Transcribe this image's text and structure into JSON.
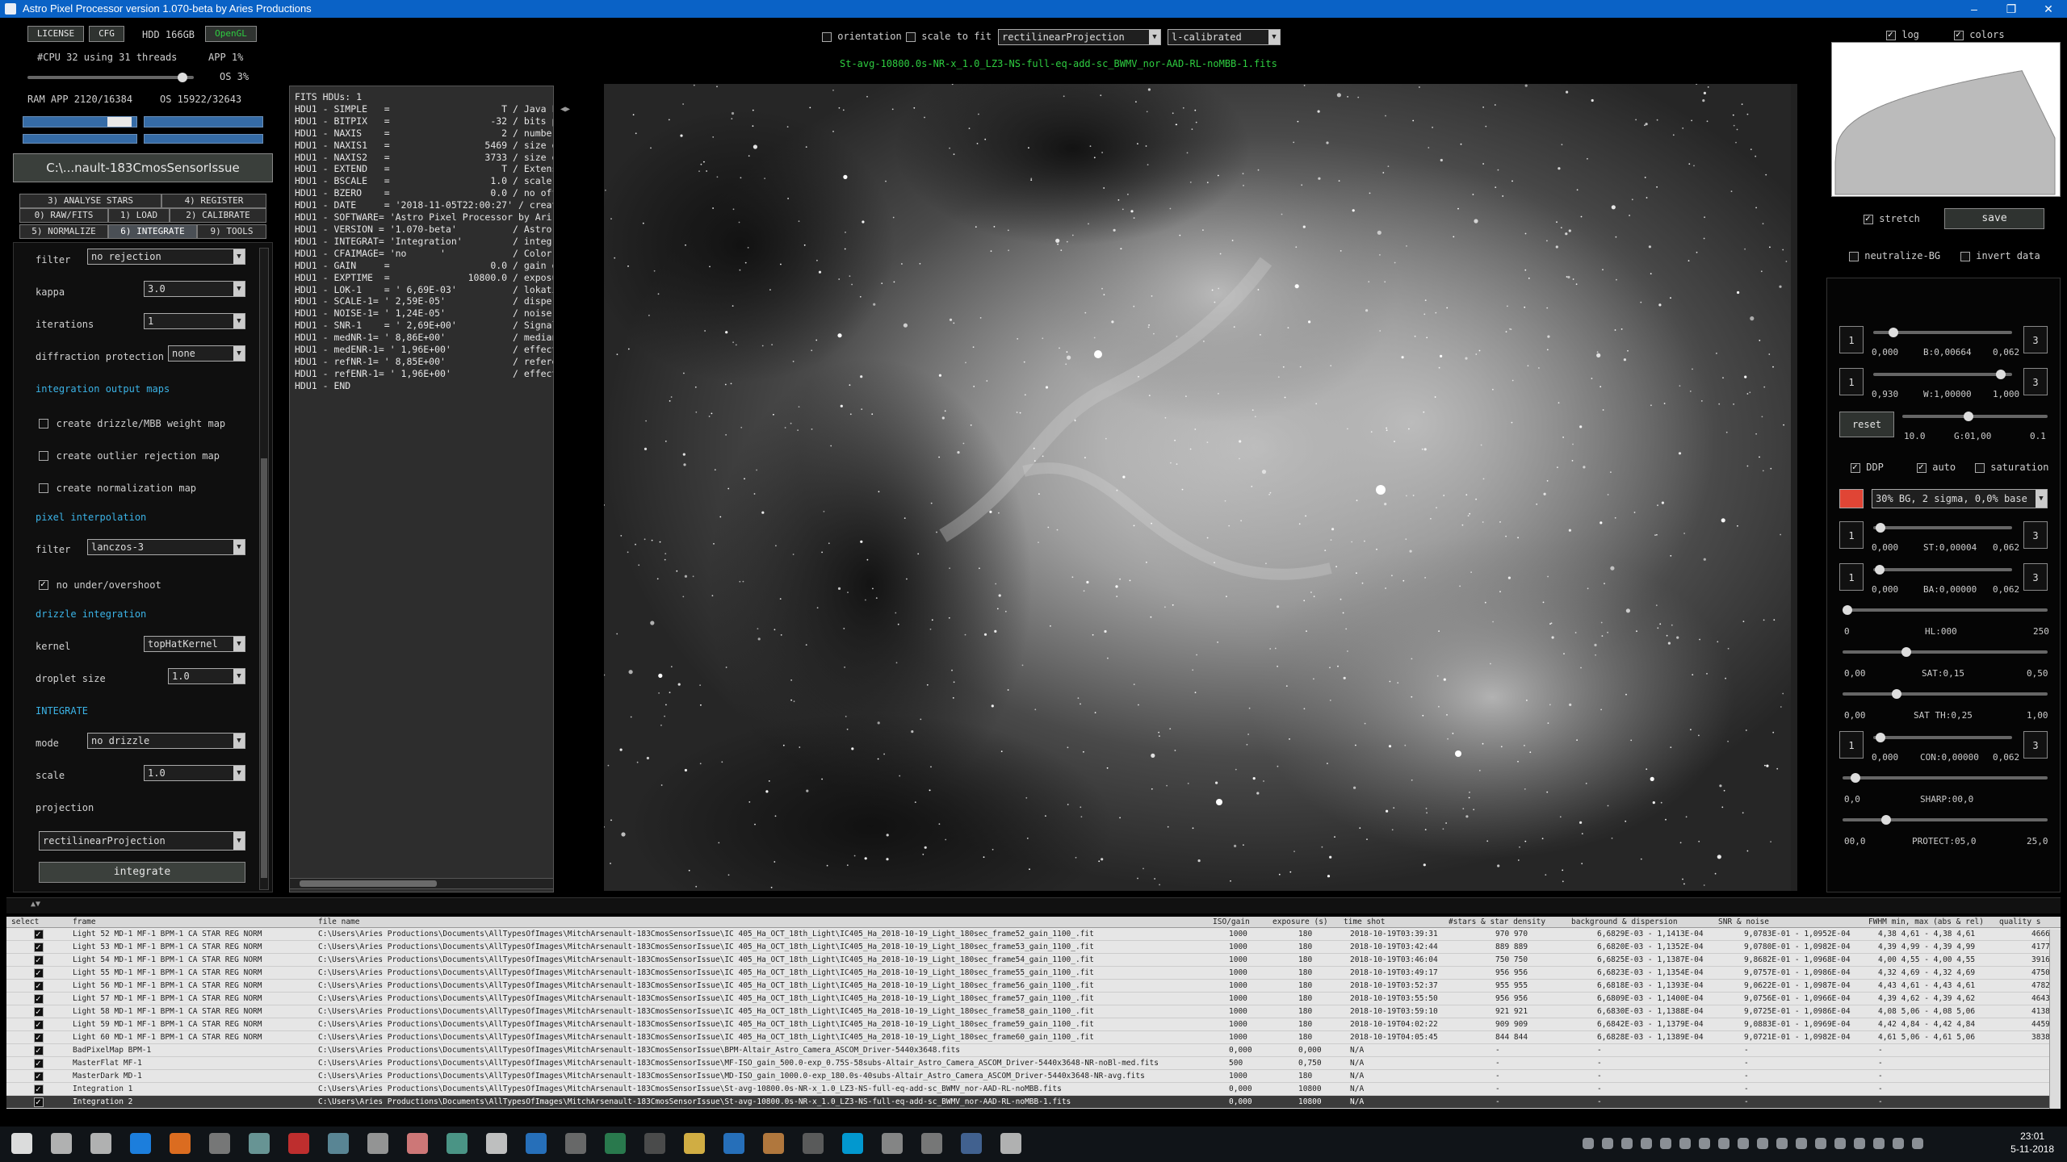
{
  "window": {
    "title": "Astro Pixel Processor version 1.070-beta by Aries Productions",
    "controls": [
      "–",
      "❐",
      "✕"
    ]
  },
  "topleft": {
    "license_label": "LICENSE",
    "cfg_label": "CFG",
    "hdd_label": "HDD 166GB",
    "opengl_label": "OpenGL",
    "cpu_text": "#CPU 32   using 31 threads",
    "app_cpu": "APP 1%",
    "os_cpu": "OS 3%",
    "ram_text": "RAM   APP 2120/16384",
    "os_ram": "OS 15922/32643",
    "working_dir": "C:\\...nault-183CmosSensorIssue"
  },
  "tabs": {
    "row1": [
      "3) ANALYSE STARS",
      "4) REGISTER"
    ],
    "row2": [
      "0) RAW/FITS",
      "1) LOAD",
      "2) CALIBRATE"
    ],
    "row3": [
      "5) NORMALIZE",
      "6) INTEGRATE",
      "9) TOOLS"
    ]
  },
  "integrate_panel": {
    "filter_label": "filter",
    "filter_value": "no rejection",
    "kappa_label": "kappa",
    "kappa_value": "3.0",
    "iterations_label": "iterations",
    "iterations_value": "1",
    "diffraction_label": "diffraction protection",
    "diffraction_value": "none",
    "output_maps_header": "integration output maps",
    "drizzle_weight": "create drizzle/MBB weight map",
    "outlier_map": "create outlier rejection map",
    "normalization_map": "create normalization map",
    "pixel_interp_header": "pixel interpolation",
    "interp_filter_label": "filter",
    "interp_filter_value": "lanczos-3",
    "no_overshoot": "no under/overshoot",
    "drizzle_header": "drizzle integration",
    "kernel_label": "kernel",
    "kernel_value": "topHatKernel",
    "droplet_label": "droplet size",
    "droplet_value": "1.0",
    "integrate_header": "INTEGRATE",
    "mode_label": "mode",
    "mode_value": "no drizzle",
    "scale_label": "scale",
    "scale_value": "1.0",
    "projection_label": "projection",
    "projection_value": "rectilinearProjection",
    "integrate_button": "integrate"
  },
  "fits_header": {
    "lines": [
      "FITS HDUs: 1",
      "HDU1 - SIMPLE   =                    T / Java F",
      "HDU1 - BITPIX   =                  -32 / bits p",
      "HDU1 - NAXIS    =                    2 / number",
      "HDU1 - NAXIS1   =                 5469 / size o",
      "HDU1 - NAXIS2   =                 3733 / size o",
      "HDU1 - EXTEND   =                    T / Extens",
      "HDU1 - BSCALE   =                  1.0 / scale ",
      "HDU1 - BZERO    =                  0.0 / no off",
      "HDU1 - DATE     = '2018-11-05T22:00:27' / creat",
      "HDU1 - SOFTWARE= 'Astro Pixel Processor by Ari",
      "HDU1 - VERSION = '1.070-beta'          / Astro ",
      "HDU1 - INTEGRAT= 'Integration'         / integr",
      "HDU1 - CFAIMAGE= 'no      '            / Color ",
      "HDU1 - GAIN     =                  0.0 / gain o",
      "HDU1 - EXPTIME  =              10800.0 / exposu",
      "HDU1 - LOK-1    = ' 6,69E-03'          / lokati",
      "HDU1 - SCALE-1= ' 2,59E-05'            / disper",
      "HDU1 - NOISE-1= ' 1,24E-05'            / noise ",
      "HDU1 - SNR-1    = ' 2,69E+00'          / Signal",
      "HDU1 - medNR-1= ' 8,86E+00'            / median",
      "HDU1 - medENR-1= ' 1,96E+00'           / effect",
      "HDU1 - refNR-1= ' 8,85E+00'            / refere",
      "HDU1 - refENR-1= ' 1,96E+00'           / effect",
      "HDU1 - END"
    ]
  },
  "viewer_top": {
    "orientation_label": "orientation",
    "scale_to_fit_label": "scale to fit",
    "projection_value": "rectilinearProjection",
    "calib_value": "l-calibrated",
    "filename": "St-avg-10800.0s-NR-x_1.0_LZ3-NS-full-eq-add-sc_BWMV_nor-AAD-RL-noMBB-1.fits"
  },
  "right_panel": {
    "log_label": "log",
    "colors_label": "colors",
    "stretch_label": "stretch",
    "save_label": "save",
    "neutralize_label": "neutralize-BG",
    "invert_label": "invert data",
    "b_left": "0,000",
    "b_label": "B:0,00664",
    "b_right": "0,062",
    "w_left": "0,930",
    "w_label": "W:1,00000",
    "w_right": "1,000",
    "reset_label": "reset",
    "g_left": "10.0",
    "g_label": "G:01,00",
    "g_right": "0.1",
    "ddp_label": "DDP",
    "auto_label": "auto",
    "saturation_label": "saturation",
    "preset_value": "30% BG, 2 sigma, 0,0% base",
    "st_left": "0,000",
    "st_label": "ST:0,00004",
    "st_right": "0,062",
    "ba_left": "0,000",
    "ba_label": "BA:0,00000",
    "ba_right": "0,062",
    "hl_left": "0",
    "hl_label": "HL:000",
    "hl_right": "250",
    "sat_left": "0,00",
    "sat_label": "SAT:0,15",
    "sat_right": "0,50",
    "sat_th_left": "0,00",
    "sat_th_label": "SAT TH:0,25",
    "sat_th_right": "1,00",
    "con_left": "0,000",
    "con_label": "CON:0,00000",
    "con_right": "0,062",
    "sharp_left": "0,0",
    "sharp_label": "SHARP:00,0",
    "sharp_right": "",
    "protect_left": "00,0",
    "protect_label": "PROTECT:05,0",
    "protect_right": "25,0",
    "step_label": "1",
    "step_label_r": "3",
    "slider_levels": {
      "b": 0.12,
      "w": 0.95,
      "g": 0.45,
      "st": 0.02,
      "ba": 0.01,
      "hl": 0.0,
      "sat": 0.3,
      "sat_th": 0.25,
      "con": 0.02,
      "sharp": 0.04,
      "protect": 0.2
    }
  },
  "table": {
    "headers": [
      "select",
      "frame",
      "file name",
      "ISO/gain",
      "exposure (s)",
      "time shot",
      "#stars & star density",
      "background & dispersion",
      "SNR & noise",
      "FWHM min, max (abs & rel)",
      "quality s"
    ],
    "rows": [
      {
        "frame": "Light 52   MD-1   MF-1   BPM-1   CA STAR REG NORM",
        "file": "C:\\Users\\Aries Productions\\Documents\\AllTypesOfImages\\MitchArsenault-183CmosSensorIssue\\IC 405_Ha_OCT_18th_Light\\IC405_Ha_2018-10-19_Light_180sec_frame52_gain_1100_.fit",
        "iso": "1000",
        "exp": "180",
        "time": "2018-10-19T03:39:31",
        "stars": "970 970",
        "bg": "6,6829E-03 - 1,1413E-04",
        "snr": "9,0783E-01 - 1,0952E-04",
        "fwhm": "4,38 4,61 - 4,38 4,61",
        "q": "4666,"
      },
      {
        "frame": "Light 53   MD-1   MF-1   BPM-1   CA STAR REG NORM",
        "file": "C:\\Users\\Aries Productions\\Documents\\AllTypesOfImages\\MitchArsenault-183CmosSensorIssue\\IC 405_Ha_OCT_18th_Light\\IC405_Ha_2018-10-19_Light_180sec_frame53_gain_1100_.fit",
        "iso": "1000",
        "exp": "180",
        "time": "2018-10-19T03:42:44",
        "stars": "889 889",
        "bg": "6,6820E-03 - 1,1352E-04",
        "snr": "9,0780E-01 - 1,0982E-04",
        "fwhm": "4,39 4,99 - 4,39 4,99",
        "q": "4177,"
      },
      {
        "frame": "Light 54   MD-1   MF-1   BPM-1   CA STAR REG NORM",
        "file": "C:\\Users\\Aries Productions\\Documents\\AllTypesOfImages\\MitchArsenault-183CmosSensorIssue\\IC 405_Ha_OCT_18th_Light\\IC405_Ha_2018-10-19_Light_180sec_frame54_gain_1100_.fit",
        "iso": "1000",
        "exp": "180",
        "time": "2018-10-19T03:46:04",
        "stars": "750 750",
        "bg": "6,6825E-03 - 1,1387E-04",
        "snr": "9,8682E-01 - 1,0968E-04",
        "fwhm": "4,00 4,55 - 4,00 4,55",
        "q": "3916,"
      },
      {
        "frame": "Light 55   MD-1   MF-1   BPM-1   CA STAR REG NORM",
        "file": "C:\\Users\\Aries Productions\\Documents\\AllTypesOfImages\\MitchArsenault-183CmosSensorIssue\\IC 405_Ha_OCT_18th_Light\\IC405_Ha_2018-10-19_Light_180sec_frame55_gain_1100_.fit",
        "iso": "1000",
        "exp": "180",
        "time": "2018-10-19T03:49:17",
        "stars": "956 956",
        "bg": "6,6823E-03 - 1,1354E-04",
        "snr": "9,0757E-01 - 1,0986E-04",
        "fwhm": "4,32 4,69 - 4,32 4,69",
        "q": "4750,"
      },
      {
        "frame": "Light 56   MD-1   MF-1   BPM-1   CA STAR REG NORM",
        "file": "C:\\Users\\Aries Productions\\Documents\\AllTypesOfImages\\MitchArsenault-183CmosSensorIssue\\IC 405_Ha_OCT_18th_Light\\IC405_Ha_2018-10-19_Light_180sec_frame56_gain_1100_.fit",
        "iso": "1000",
        "exp": "180",
        "time": "2018-10-19T03:52:37",
        "stars": "955 955",
        "bg": "6,6818E-03 - 1,1393E-04",
        "snr": "9,0622E-01 - 1,0987E-04",
        "fwhm": "4,43 4,61 - 4,43 4,61",
        "q": "4782,"
      },
      {
        "frame": "Light 57   MD-1   MF-1   BPM-1   CA STAR REG NORM",
        "file": "C:\\Users\\Aries Productions\\Documents\\AllTypesOfImages\\MitchArsenault-183CmosSensorIssue\\IC 405_Ha_OCT_18th_Light\\IC405_Ha_2018-10-19_Light_180sec_frame57_gain_1100_.fit",
        "iso": "1000",
        "exp": "180",
        "time": "2018-10-19T03:55:50",
        "stars": "956 956",
        "bg": "6,6809E-03 - 1,1400E-04",
        "snr": "9,0756E-01 - 1,0966E-04",
        "fwhm": "4,39 4,62 - 4,39 4,62",
        "q": "4643,"
      },
      {
        "frame": "Light 58   MD-1   MF-1   BPM-1   CA STAR REG NORM",
        "file": "C:\\Users\\Aries Productions\\Documents\\AllTypesOfImages\\MitchArsenault-183CmosSensorIssue\\IC 405_Ha_OCT_18th_Light\\IC405_Ha_2018-10-19_Light_180sec_frame58_gain_1100_.fit",
        "iso": "1000",
        "exp": "180",
        "time": "2018-10-19T03:59:10",
        "stars": "921 921",
        "bg": "6,6830E-03 - 1,1388E-04",
        "snr": "9,0725E-01 - 1,0986E-04",
        "fwhm": "4,08 5,06 - 4,08 5,06",
        "q": "4138,"
      },
      {
        "frame": "Light 59   MD-1   MF-1   BPM-1   CA STAR REG NORM",
        "file": "C:\\Users\\Aries Productions\\Documents\\AllTypesOfImages\\MitchArsenault-183CmosSensorIssue\\IC 405_Ha_OCT_18th_Light\\IC405_Ha_2018-10-19_Light_180sec_frame59_gain_1100_.fit",
        "iso": "1000",
        "exp": "180",
        "time": "2018-10-19T04:02:22",
        "stars": "909 909",
        "bg": "6,6842E-03 - 1,1379E-04",
        "snr": "9,0883E-01 - 1,0969E-04",
        "fwhm": "4,42 4,84 - 4,42 4,84",
        "q": "4459,"
      },
      {
        "frame": "Light 60   MD-1   MF-1   BPM-1   CA STAR REG NORM",
        "file": "C:\\Users\\Aries Productions\\Documents\\AllTypesOfImages\\MitchArsenault-183CmosSensorIssue\\IC 405_Ha_OCT_18th_Light\\IC405_Ha_2018-10-19_Light_180sec_frame60_gain_1100_.fit",
        "iso": "1000",
        "exp": "180",
        "time": "2018-10-19T04:05:45",
        "stars": "844 844",
        "bg": "6,6828E-03 - 1,1389E-04",
        "snr": "9,0721E-01 - 1,0982E-04",
        "fwhm": "4,61 5,06 - 4,61 5,06",
        "q": "3838,"
      },
      {
        "frame": "BadPixelMap  BPM-1",
        "file": "C:\\Users\\Aries Productions\\Documents\\AllTypesOfImages\\MitchArsenault-183CmosSensorIssue\\BPM-Altair_Astro_Camera_ASCOM_Driver-5440x3648.fits",
        "iso": "0,000",
        "exp": "0,000",
        "time": "N/A",
        "stars": "-",
        "bg": "-",
        "snr": "-",
        "fwhm": "-",
        "q": ""
      },
      {
        "frame": "MasterFlat  MF-1",
        "file": "C:\\Users\\Aries Productions\\Documents\\AllTypesOfImages\\MitchArsenault-183CmosSensorIssue\\MF-ISO_gain_500.0-exp_0.75S-58subs-Altair_Astro_Camera_ASCOM_Driver-5440x3648-NR-noBl-med.fits",
        "iso": "500",
        "exp": "0,750",
        "time": "N/A",
        "stars": "-",
        "bg": "-",
        "snr": "-",
        "fwhm": "-",
        "q": ""
      },
      {
        "frame": "MasterDark  MD-1",
        "file": "C:\\Users\\Aries Productions\\Documents\\AllTypesOfImages\\MitchArsenault-183CmosSensorIssue\\MD-ISO_gain_1000.0-exp_180.0s-40subs-Altair_Astro_Camera_ASCOM_Driver-5440x3648-NR-avg.fits",
        "iso": "1000",
        "exp": "180",
        "time": "N/A",
        "stars": "-",
        "bg": "-",
        "snr": "-",
        "fwhm": "-",
        "q": ""
      },
      {
        "frame": "Integration 1",
        "file": "C:\\Users\\Aries Productions\\Documents\\AllTypesOfImages\\MitchArsenault-183CmosSensorIssue\\St-avg-10800.0s-NR-x_1.0_LZ3-NS-full-eq-add-sc_BWMV_nor-AAD-RL-noMBB.fits",
        "iso": "0,000",
        "exp": "10800",
        "time": "N/A",
        "stars": "-",
        "bg": "-",
        "snr": "-",
        "fwhm": "-",
        "q": ""
      },
      {
        "frame": "Integration 2",
        "file": "C:\\Users\\Aries Productions\\Documents\\AllTypesOfImages\\MitchArsenault-183CmosSensorIssue\\St-avg-10800.0s-NR-x_1.0_LZ3-NS-full-eq-add-sc_BWMV_nor-AAD-RL-noMBB-1.fits",
        "iso": "0,000",
        "exp": "10800",
        "time": "N/A",
        "stars": "-",
        "bg": "-",
        "snr": "-",
        "fwhm": "-",
        "q": ""
      }
    ]
  },
  "taskbar": {
    "time": "23:01",
    "date": "5-11-2018",
    "icons": [
      "start-icon",
      "search-icon",
      "task-view-icon",
      "edge-icon",
      "firefox-icon",
      "app-icon-1",
      "app-icon-2",
      "filezilla-icon",
      "app-icon-3",
      "app-icon-4",
      "app-icon-5",
      "app-icon-6",
      "app-icon-7",
      "outlook-icon",
      "app-icon-8",
      "excel-icon",
      "7zip-icon",
      "explorer-icon",
      "outlook2-icon",
      "app-icon-9",
      "app-icon-10",
      "skype-icon",
      "app-icon-11",
      "app-icon-12",
      "astro-pixel-processor-icon",
      "app-icon-13"
    ]
  }
}
